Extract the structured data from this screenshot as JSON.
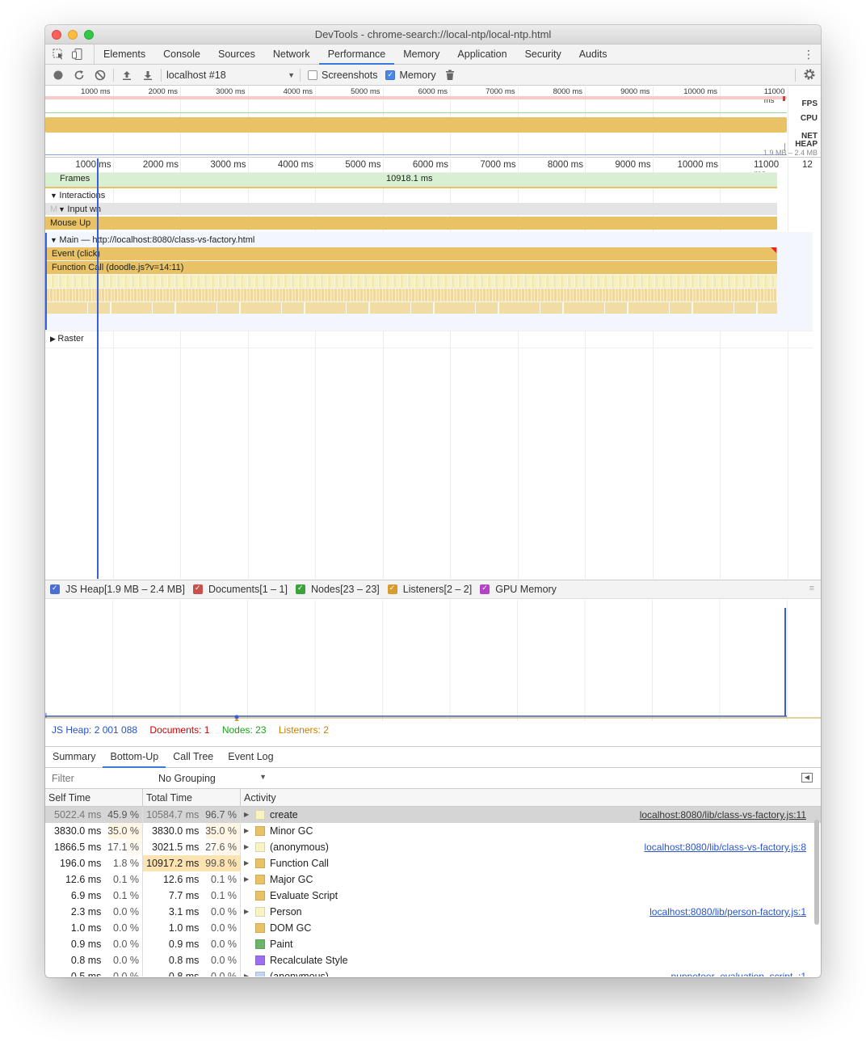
{
  "window": {
    "title": "DevTools - chrome-search://local-ntp/local-ntp.html"
  },
  "tabs": [
    {
      "label": "Elements"
    },
    {
      "label": "Console"
    },
    {
      "label": "Sources"
    },
    {
      "label": "Network"
    },
    {
      "label": "Performance"
    },
    {
      "label": "Memory"
    },
    {
      "label": "Application"
    },
    {
      "label": "Security"
    },
    {
      "label": "Audits"
    }
  ],
  "active_tab": "Performance",
  "toolbar": {
    "profile": "localhost #18",
    "screenshots_label": "Screenshots",
    "screenshots_checked": false,
    "memory_label": "Memory",
    "memory_checked": true
  },
  "overview": {
    "ticks": [
      "1000 ms",
      "2000 ms",
      "3000 ms",
      "4000 ms",
      "5000 ms",
      "6000 ms",
      "7000 ms",
      "8000 ms",
      "9000 ms",
      "10000 ms",
      "11000 ms"
    ],
    "labels": {
      "fps": "FPS",
      "cpu": "CPU",
      "net": "NET",
      "heap": "HEAP"
    },
    "heap_range": "1.9 MB – 2.4 MB"
  },
  "flamechart": {
    "ticks": [
      "1000 ms",
      "2000 ms",
      "3000 ms",
      "4000 ms",
      "5000 ms",
      "6000 ms",
      "7000 ms",
      "8000 ms",
      "9000 ms",
      "10000 ms",
      "11000 ms",
      "12"
    ],
    "frames_label": "Frames",
    "frame_duration": "10918.1 ms",
    "interactions_label": "Interactions",
    "input_label": "Input",
    "input_ghost": "M",
    "input_suffix": "wn",
    "mouse_up": "Mouse Up",
    "main_label": "Main — http://localhost:8080/class-vs-factory.html",
    "event_click": "Event (click)",
    "function_call": "Function Call (doodle.js?v=14:11)",
    "raster_label": "Raster"
  },
  "memory": {
    "legend": [
      {
        "label": "JS Heap[1.9 MB – 2.4 MB]",
        "color": "#4a6ed1"
      },
      {
        "label": "Documents[1 – 1]",
        "color": "#c8514e"
      },
      {
        "label": "Nodes[23 – 23]",
        "color": "#3ca33c"
      },
      {
        "label": "Listeners[2 – 2]",
        "color": "#d69c2e"
      },
      {
        "label": "GPU Memory",
        "color": "#b342c6"
      }
    ],
    "counts": {
      "js_heap": "JS Heap: 2 001 088",
      "documents": "Documents: 1",
      "nodes": "Nodes: 23",
      "listeners": "Listeners: 2"
    },
    "colors": {
      "js_heap": "#2752c6",
      "documents": "#c80000",
      "nodes": "#1aa31a",
      "listeners": "#c77d00"
    }
  },
  "bottom": {
    "tabs": [
      {
        "label": "Summary"
      },
      {
        "label": "Bottom-Up"
      },
      {
        "label": "Call Tree"
      },
      {
        "label": "Event Log"
      }
    ],
    "active_tab": "Bottom-Up",
    "filter_placeholder": "Filter",
    "grouping": "No Grouping",
    "columns": {
      "self": "Self Time",
      "total": "Total Time",
      "activity": "Activity"
    },
    "rows": [
      {
        "self_ms": "5022.4 ms",
        "self_pct": "45.9 %",
        "total_ms": "10584.7 ms",
        "total_pct": "96.7 %",
        "expandable": true,
        "color": "#f6f3c4",
        "name": "create",
        "link": "localhost:8080/lib/class-vs-factory.js:11",
        "selected": true
      },
      {
        "self_ms": "3830.0 ms",
        "self_pct": "35.0 %",
        "total_ms": "3830.0 ms",
        "total_pct": "35.0 %",
        "expandable": true,
        "color": "#e8c264",
        "name": "Minor GC",
        "link": ""
      },
      {
        "self_ms": "1866.5 ms",
        "self_pct": "17.1 %",
        "total_ms": "3021.5 ms",
        "total_pct": "27.6 %",
        "expandable": true,
        "color": "#f6f3c4",
        "name": "(anonymous)",
        "link": "localhost:8080/lib/class-vs-factory.js:8"
      },
      {
        "self_ms": "196.0 ms",
        "self_pct": "1.8 %",
        "total_ms": "10917.2 ms",
        "total_pct": "99.8 %",
        "expandable": true,
        "color": "#e8c264",
        "name": "Function Call",
        "link": ""
      },
      {
        "self_ms": "12.6 ms",
        "self_pct": "0.1 %",
        "total_ms": "12.6 ms",
        "total_pct": "0.1 %",
        "expandable": true,
        "color": "#e8c264",
        "name": "Major GC",
        "link": ""
      },
      {
        "self_ms": "6.9 ms",
        "self_pct": "0.1 %",
        "total_ms": "7.7 ms",
        "total_pct": "0.1 %",
        "expandable": false,
        "color": "#e8c264",
        "name": "Evaluate Script",
        "link": ""
      },
      {
        "self_ms": "2.3 ms",
        "self_pct": "0.0 %",
        "total_ms": "3.1 ms",
        "total_pct": "0.0 %",
        "expandable": true,
        "color": "#f6f3c4",
        "name": "Person",
        "link": "localhost:8080/lib/person-factory.js:1"
      },
      {
        "self_ms": "1.0 ms",
        "self_pct": "0.0 %",
        "total_ms": "1.0 ms",
        "total_pct": "0.0 %",
        "expandable": false,
        "color": "#e8c264",
        "name": "DOM GC",
        "link": ""
      },
      {
        "self_ms": "0.9 ms",
        "self_pct": "0.0 %",
        "total_ms": "0.9 ms",
        "total_pct": "0.0 %",
        "expandable": false,
        "color": "#6ab56a",
        "name": "Paint",
        "link": ""
      },
      {
        "self_ms": "0.8 ms",
        "self_pct": "0.0 %",
        "total_ms": "0.8 ms",
        "total_pct": "0.0 %",
        "expandable": false,
        "color": "#9d6ef0",
        "name": "Recalculate Style",
        "link": ""
      },
      {
        "self_ms": "0.5 ms",
        "self_pct": "0.0 %",
        "total_ms": "0.8 ms",
        "total_pct": "0.0 %",
        "expandable": true,
        "color": "#c4d6f2",
        "name": "(anonymous)",
        "link": "puppeteer_evaluation_script_:1"
      }
    ]
  }
}
